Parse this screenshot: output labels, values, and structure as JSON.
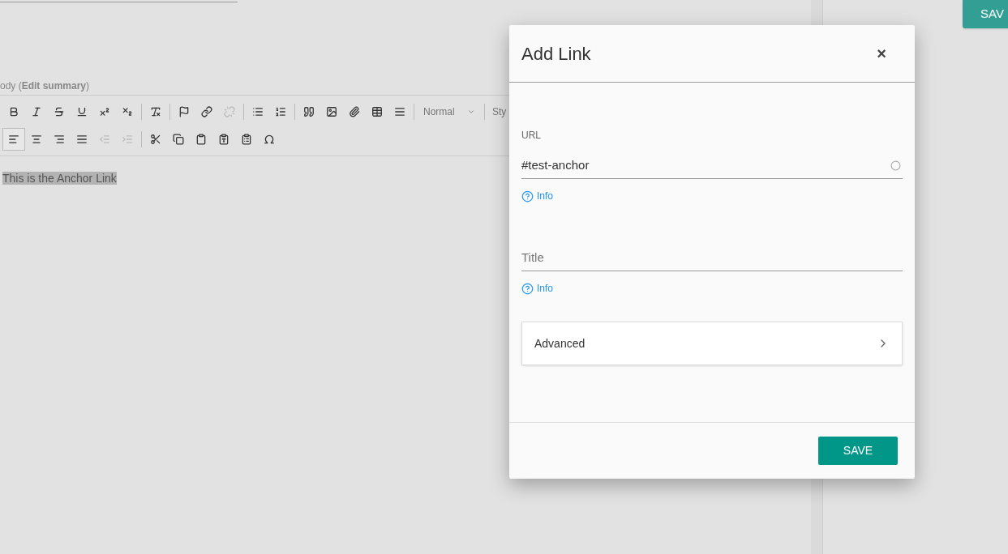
{
  "page": {
    "save_button": "SAV",
    "body_label": "ody (**Edit summary**)",
    "editor_text": "This is the Anchor Link"
  },
  "toolbar": {
    "rows": [
      [
        {
          "kind": "button",
          "disabled": false,
          "selected": false
        },
        {
          "kind": "button",
          "disabled": false,
          "selected": false
        },
        {
          "kind": "button",
          "disabled": false,
          "selected": false
        },
        {
          "kind": "button",
          "disabled": false,
          "selected": false
        },
        {
          "kind": "button",
          "disabled": false,
          "selected": false
        },
        {
          "kind": "button",
          "disabled": false,
          "selected": false
        },
        {
          "kind": "separator"
        },
        {
          "kind": "button",
          "disabled": false,
          "selected": false
        },
        {
          "kind": "separator"
        },
        {
          "kind": "button",
          "disabled": false,
          "selected": false
        },
        {
          "kind": "button",
          "disabled": false,
          "selected": false
        },
        {
          "kind": "button",
          "disabled": true,
          "selected": false
        },
        {
          "kind": "separator"
        },
        {
          "kind": "button",
          "disabled": false,
          "selected": false
        },
        {
          "kind": "button",
          "disabled": false,
          "selected": false
        },
        {
          "kind": "separator"
        },
        {
          "kind": "button",
          "disabled": false,
          "selected": false
        },
        {
          "kind": "button",
          "disabled": false,
          "selected": false
        },
        {
          "kind": "button",
          "disabled": false,
          "selected": false
        },
        {
          "kind": "button",
          "disabled": false,
          "selected": false
        },
        {
          "kind": "button",
          "disabled": false,
          "selected": false
        },
        {
          "kind": "separator"
        },
        {
          "kind": "dropdown",
          "label": "Normal"
        },
        {
          "kind": "separator"
        },
        {
          "kind": "dropdown_cut",
          "label": "Sty"
        }
      ],
      [
        {
          "kind": "button",
          "disabled": false,
          "selected": true
        },
        {
          "kind": "button",
          "disabled": false,
          "selected": false
        },
        {
          "kind": "button",
          "disabled": false,
          "selected": false
        },
        {
          "kind": "button",
          "disabled": false,
          "selected": false
        },
        {
          "kind": "button",
          "disabled": true,
          "selected": false
        },
        {
          "kind": "button",
          "disabled": true,
          "selected": false
        },
        {
          "kind": "separator"
        },
        {
          "kind": "button",
          "disabled": false,
          "selected": false
        },
        {
          "kind": "button",
          "disabled": false,
          "selected": false
        },
        {
          "kind": "button",
          "disabled": false,
          "selected": false
        },
        {
          "kind": "button",
          "disabled": false,
          "selected": false
        },
        {
          "kind": "button",
          "disabled": false,
          "selected": false
        },
        {
          "kind": "button",
          "disabled": false,
          "selected": false
        }
      ]
    ]
  },
  "dialog": {
    "title": "Add Link",
    "close": "×",
    "fields": [
      {
        "label": "URL",
        "value": "#test-anchor",
        "info": "Info"
      },
      {
        "placeholder": "Title",
        "info": "Info"
      }
    ],
    "advanced": {
      "label": "Advanced",
      "expanded": false
    },
    "save": "SAVE"
  }
}
